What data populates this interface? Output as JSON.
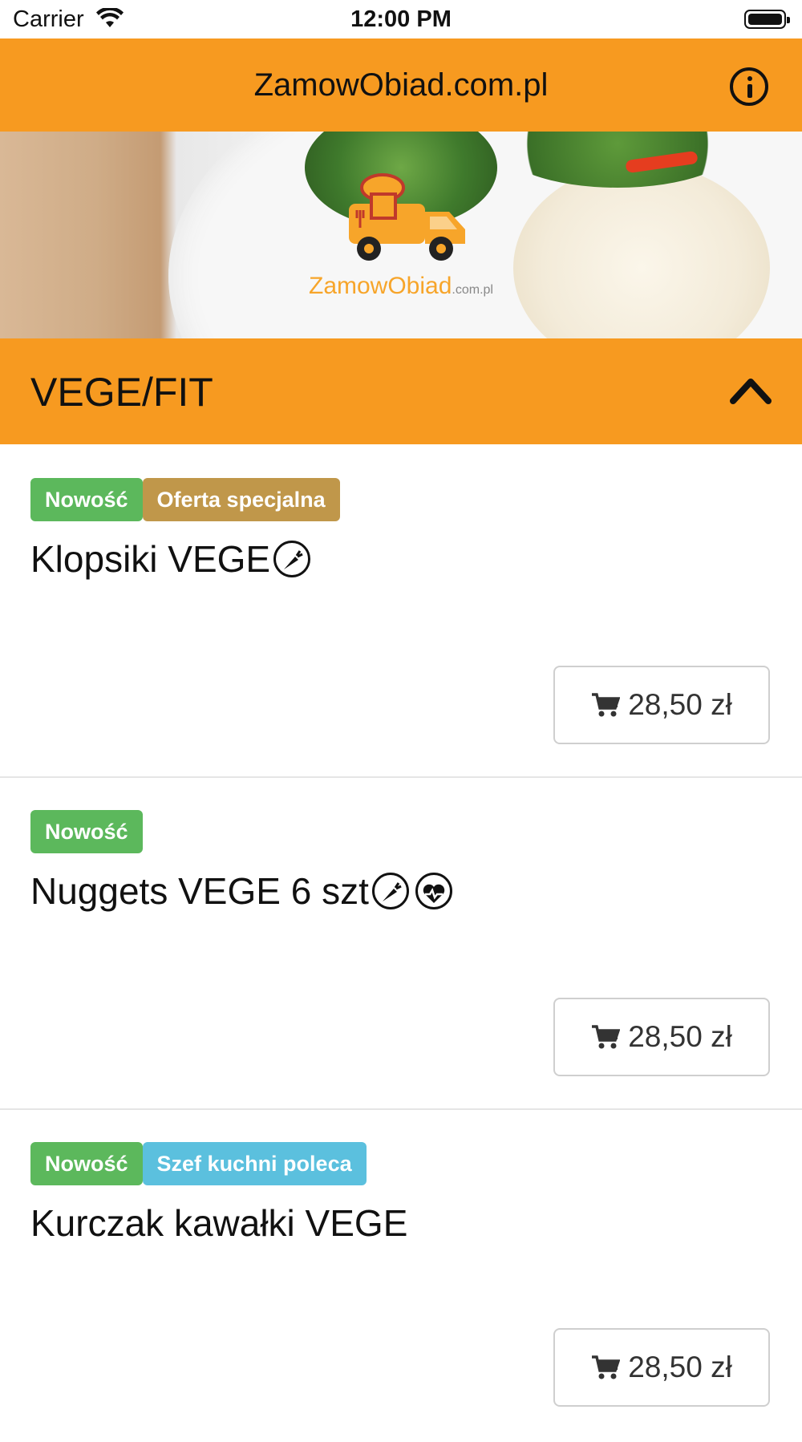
{
  "status_bar": {
    "carrier": "Carrier",
    "time": "12:00 PM"
  },
  "nav": {
    "title": "ZamowObiad.com.pl",
    "info_icon": "info-circle-icon"
  },
  "hero": {
    "logo_text": "ZamowObiad",
    "logo_suffix": ".com.pl"
  },
  "category": {
    "title": "VEGE/FIT",
    "toggle_icon": "chevron-up-icon"
  },
  "colors": {
    "accent": "#f79a20",
    "badge_new": "#5cb85c",
    "badge_offer": "#c0974a",
    "badge_chef": "#5bc0de"
  },
  "items": [
    {
      "badges": [
        "Nowość",
        "Oferta specjalna"
      ],
      "name": "Klopsiki VEGE",
      "icons": [
        "carrot-icon"
      ],
      "price": "28,50 zł"
    },
    {
      "badges": [
        "Nowość"
      ],
      "name": "Nuggets VEGE 6 szt",
      "icons": [
        "carrot-icon",
        "heart-pulse-icon"
      ],
      "price": "28,50 zł"
    },
    {
      "badges": [
        "Nowość",
        "Szef kuchni poleca"
      ],
      "name": "Kurczak kawałki VEGE",
      "icons": [],
      "price": "28,50 zł"
    }
  ]
}
